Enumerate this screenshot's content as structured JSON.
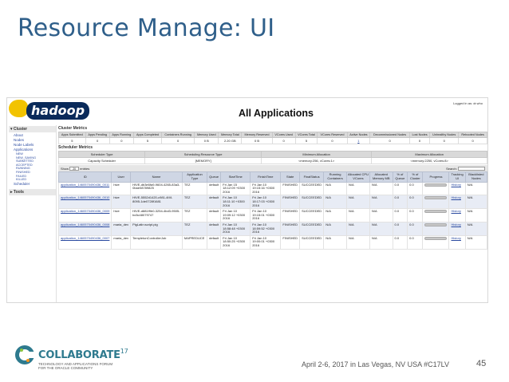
{
  "slide": {
    "title": "Resource Manage: UI",
    "footer_text": "April 2-6, 2017 in Las Vegas, NV USA   #C17LV",
    "page_number": "45"
  },
  "brand": {
    "name": "COLLABORATE",
    "year": "17",
    "tagline_1": "TECHNOLOGY AND APPLICATIONS FORUM",
    "tagline_2": "FOR THE ORACLE COMMUNITY"
  },
  "yarn": {
    "logo_text": "hadoop",
    "page_title": "All Applications",
    "logged_in": "Logged in as: dr.who",
    "sidebar": {
      "cluster_label": "Cluster",
      "items": [
        "About",
        "Nodes",
        "Node Labels",
        "Applications"
      ],
      "app_states": [
        "NEW",
        "NEW_SAVING",
        "SUBMITTED",
        "ACCEPTED",
        "RUNNING",
        "FINISHED",
        "FAILED",
        "KILLED"
      ],
      "scheduler": "Scheduler",
      "tools_label": "Tools"
    },
    "cluster_metrics": {
      "label": "Cluster Metrics",
      "headers": [
        "Apps Submitted",
        "Apps Pending",
        "Apps Running",
        "Apps Completed",
        "Containers Running",
        "Memory Used",
        "Memory Total",
        "Memory Reserved",
        "VCores Used",
        "VCores Total",
        "VCores Reserved",
        "Active Nodes",
        "Decommissioned Nodes",
        "Lost Nodes",
        "Unhealthy Nodes",
        "Rebooted Nodes"
      ],
      "values": [
        "5",
        "0",
        "0",
        "5",
        "0",
        "0 B",
        "2.20 GB",
        "0 B",
        "0",
        "5",
        "0",
        "1",
        "0",
        "0",
        "0",
        "0"
      ]
    },
    "scheduler_metrics": {
      "label": "Scheduler Metrics",
      "headers": [
        "Scheduler Type",
        "Scheduling Resource Type",
        "Minimum Allocation",
        "Maximum Allocation"
      ],
      "values": [
        "Capacity Scheduler",
        "[MEMORY]",
        "<memory:256, vCores:1>",
        "<memory:2250, vCores:8>"
      ]
    },
    "controls": {
      "show_label": "Show",
      "show_value": "20",
      "entries_label": "entries",
      "search_label": "Search:"
    },
    "apps_table": {
      "headers": [
        "ID",
        "User",
        "Name",
        "Application Type",
        "Queue",
        "StartTime",
        "FinishTime",
        "State",
        "FinalStatus",
        "Running Containers",
        "Allocated CPU VCores",
        "Allocated Memory MB",
        "% of Queue",
        "% of Cluster",
        "Progress",
        "Tracking UI",
        "Blacklisted Nodes"
      ],
      "rows": [
        {
          "id": "application_1460570490436_0011",
          "user": "hive",
          "name": "HIVE-db3e6fa9-9604-4265-83a3-0bae08789825",
          "type": "TEZ",
          "queue": "default",
          "start": "Fri Jan 15 18:12:09 +0300 2016",
          "finish": "Fri Jan 10 19:15:16 +0300 2016",
          "state": "FINISHED",
          "final": "SUCCEEDED",
          "running": "N/A",
          "cpu": "N/A",
          "mem": "N/A",
          "pq": "0.0",
          "pc": "0.0",
          "tracking": "History",
          "blacklisted": "N/A"
        },
        {
          "id": "application_1460570490436_0010",
          "user": "hive",
          "name": "HIVE-5552d1420-c981-4f4f-8095-1de0728f1681",
          "type": "TEZ",
          "queue": "default",
          "start": "Fri Jan 10 18:11:10 +0300 2016",
          "finish": "Fri Jan 10 18:17:03 +0300 2016",
          "state": "FINISHED",
          "final": "SUCCEEDED",
          "running": "N/A",
          "cpu": "N/A",
          "mem": "N/A",
          "pq": "0.0",
          "pc": "0.0",
          "tracking": "History",
          "blacklisted": "N/A"
        },
        {
          "id": "application_1460570490436_0009",
          "user": "hive",
          "name": "HIVE-d881f9b0-3254-4bd3-9505-bc5c48079747",
          "type": "TEZ",
          "queue": "default",
          "start": "Fri Jan 10 19:09:12 +0300 2016",
          "finish": "Fri Jan 10 19:15:01 +0300 2016",
          "state": "FINISHED",
          "final": "SUCCEEDED",
          "running": "N/A",
          "cpu": "N/A",
          "mem": "N/A",
          "pq": "0.0",
          "pc": "0.0",
          "tracking": "History",
          "blacklisted": "N/A"
        },
        {
          "id": "application_1460570490436_0008",
          "user": "maria_dev",
          "name": "PigLatin:script.pig",
          "type": "TEZ",
          "queue": "default",
          "start": "Fri Jan 10 18:58:48 +0300 2016",
          "finish": "Fri Jan 10 18:59:52 +0300 2016",
          "state": "FINISHED",
          "final": "SUCCEEDED",
          "running": "N/A",
          "cpu": "N/A",
          "mem": "N/A",
          "pq": "0.0",
          "pc": "0.0",
          "tracking": "History",
          "blacklisted": "N/A"
        },
        {
          "id": "application_1460570490436_0007",
          "user": "maria_dev",
          "name": "TempletonControllerJob",
          "type": "MAPREDUCE",
          "queue": "default",
          "start": "Fri Jan 10 18:50:25 +0300 2016",
          "finish": "Fri Jan 10 19:00:01 +0300 2016",
          "state": "FINISHED",
          "final": "SUCCEEDED",
          "running": "N/A",
          "cpu": "N/A",
          "mem": "N/A",
          "pq": "0.0",
          "pc": "0.0",
          "tracking": "History",
          "blacklisted": "N/A"
        }
      ]
    }
  }
}
